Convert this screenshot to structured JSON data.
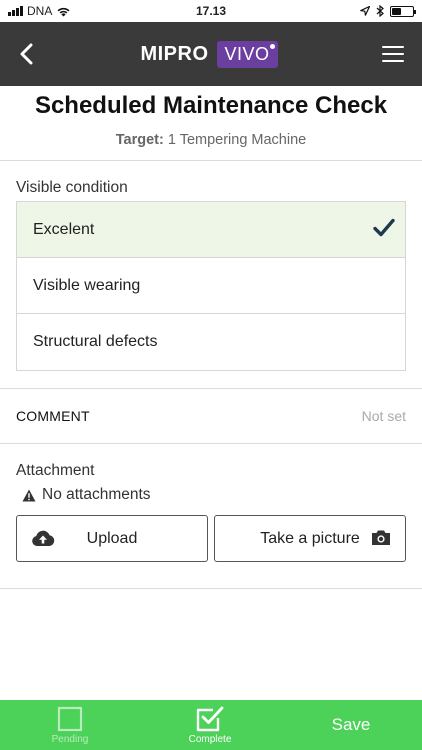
{
  "status_bar": {
    "carrier": "DNA",
    "time": "17.13",
    "battery_level": 0.45
  },
  "nav": {
    "logo_left": "MIPRO",
    "logo_right": "VIVO",
    "back_icon": "chevron-left-icon",
    "menu_icon": "hamburger-menu-icon"
  },
  "page": {
    "title": "Scheduled Maintenance Check",
    "target_label": "Target:",
    "target_value": "1 Tempering Machine"
  },
  "condition": {
    "label": "Visible condition",
    "options": [
      {
        "label": "Excelent",
        "selected": true
      },
      {
        "label": "Visible wearing",
        "selected": false
      },
      {
        "label": "Structural defects",
        "selected": false
      }
    ]
  },
  "comment": {
    "label": "COMMENT",
    "value": "Not set"
  },
  "attachment": {
    "title": "Attachment",
    "empty_text": "No attachments",
    "upload_label": "Upload",
    "picture_label": "Take a picture"
  },
  "bottom_bar": {
    "pending_label": "Pending",
    "complete_label": "Complete",
    "save_label": "Save"
  },
  "colors": {
    "nav_bg": "#3a3a3a",
    "brand_purple": "#6b3fa0",
    "accent_green": "#4cd159",
    "selected_bg": "#eef6e8",
    "check_color": "#1f3a4d"
  }
}
